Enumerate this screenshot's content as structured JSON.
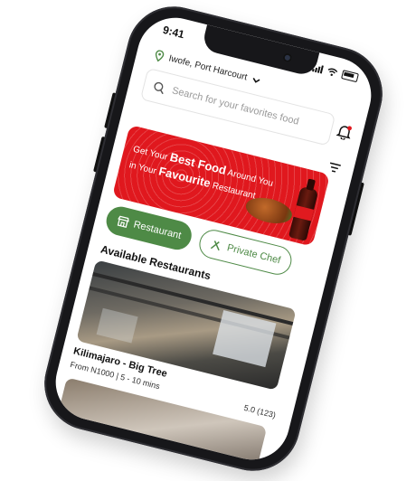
{
  "status": {
    "time": "9:41"
  },
  "location": {
    "label": "Iwofe, Port Harcourt"
  },
  "search": {
    "placeholder": "Search for your favorites food"
  },
  "banner": {
    "line1_a": "Get Your",
    "line1_b": "Best Food",
    "line1_c": "Around You",
    "line2_a": "in Your",
    "line2_b": "Favourite",
    "line2_c": "Restaurant"
  },
  "chips": {
    "restaurant": "Restaurant",
    "private_chef": "Private Chef"
  },
  "section": {
    "title": "Available Restaurants"
  },
  "restaurants": [
    {
      "name": "Kilimajaro - Big Tree",
      "price": "From N1000 | 5 - 10 mins",
      "rating": "5.0 (123)"
    }
  ],
  "colors": {
    "accent_green": "#4e8a46",
    "banner_red": "#e0181e"
  },
  "icons": [
    "location-pin-icon",
    "chevron-down-icon",
    "signal-icon",
    "wifi-icon",
    "battery-icon",
    "search-icon",
    "bell-icon",
    "filter-icon",
    "store-icon",
    "chef-icon"
  ]
}
